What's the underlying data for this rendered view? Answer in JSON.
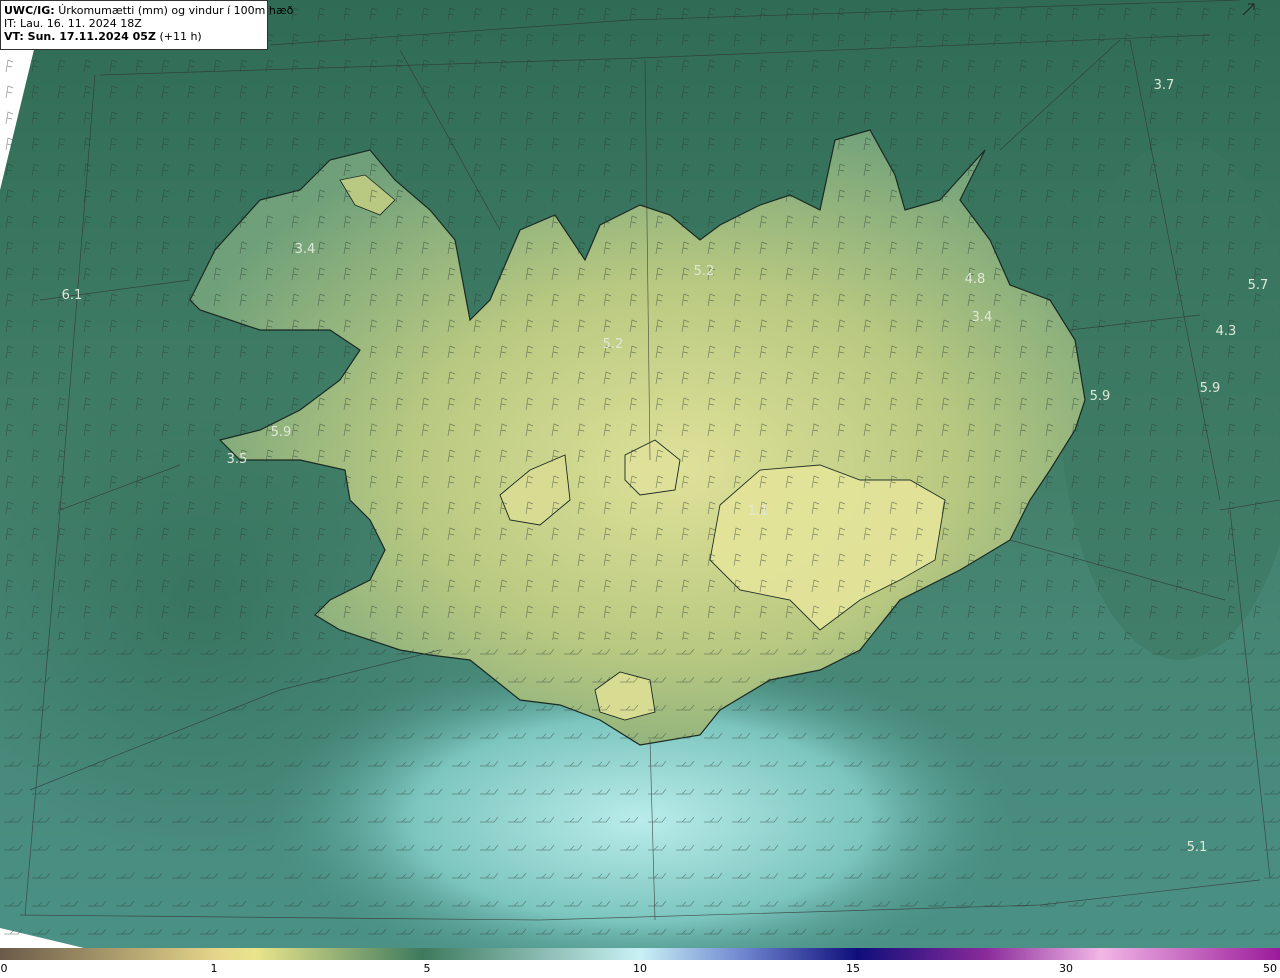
{
  "header": {
    "title_model": "UWC/IG:",
    "title_desc": "Úrkomumætti (mm) og vindur í 100m hæð",
    "it_line": "IT: Lau. 16. 11. 2024 18Z",
    "vt_label": "VT: Sun. 17.11.2024 05Z",
    "vt_offset": "(+11 h)"
  },
  "map_labels": [
    {
      "id": "label-3-7",
      "text": "3.7"
    },
    {
      "id": "label-3-4",
      "text": "3.4"
    },
    {
      "id": "label-6-1",
      "text": "6.1"
    },
    {
      "id": "label-5-2-a",
      "text": "5.2"
    },
    {
      "id": "label-5-2-b",
      "text": "5.2"
    },
    {
      "id": "label-4-8",
      "text": "4.8"
    },
    {
      "id": "label-3-4-b",
      "text": "3.4"
    },
    {
      "id": "label-5-7",
      "text": "5.7"
    },
    {
      "id": "label-4-3",
      "text": "4.3"
    },
    {
      "id": "label-5-9-a",
      "text": "5.9"
    },
    {
      "id": "label-5-9-b",
      "text": "5.9"
    },
    {
      "id": "label-5-9-c",
      "text": "5.9"
    },
    {
      "id": "label-3-5",
      "text": "3.5"
    },
    {
      "id": "label-1-1",
      "text": "1.1"
    },
    {
      "id": "label-5-1",
      "text": "5.1"
    }
  ],
  "colorbar": {
    "ticks": [
      "0",
      "1",
      "5",
      "10",
      "15",
      "30",
      "50"
    ],
    "colors": [
      "#6b5a4a",
      "#c8b887",
      "#f3e889",
      "#3e7a5e",
      "#8fd8d6",
      "#c9f1f5",
      "#2a2a9a",
      "#0e0e7a",
      "#b05ab0",
      "#e39ee0",
      "#9a1a9a"
    ]
  },
  "colors": {
    "land": "#c9d486",
    "sea_green": "#3f8066",
    "sea_light": "#8fd3cd",
    "coast": "#1a2a22"
  },
  "icons": {
    "corner": "arrow-diagonal-icon"
  }
}
